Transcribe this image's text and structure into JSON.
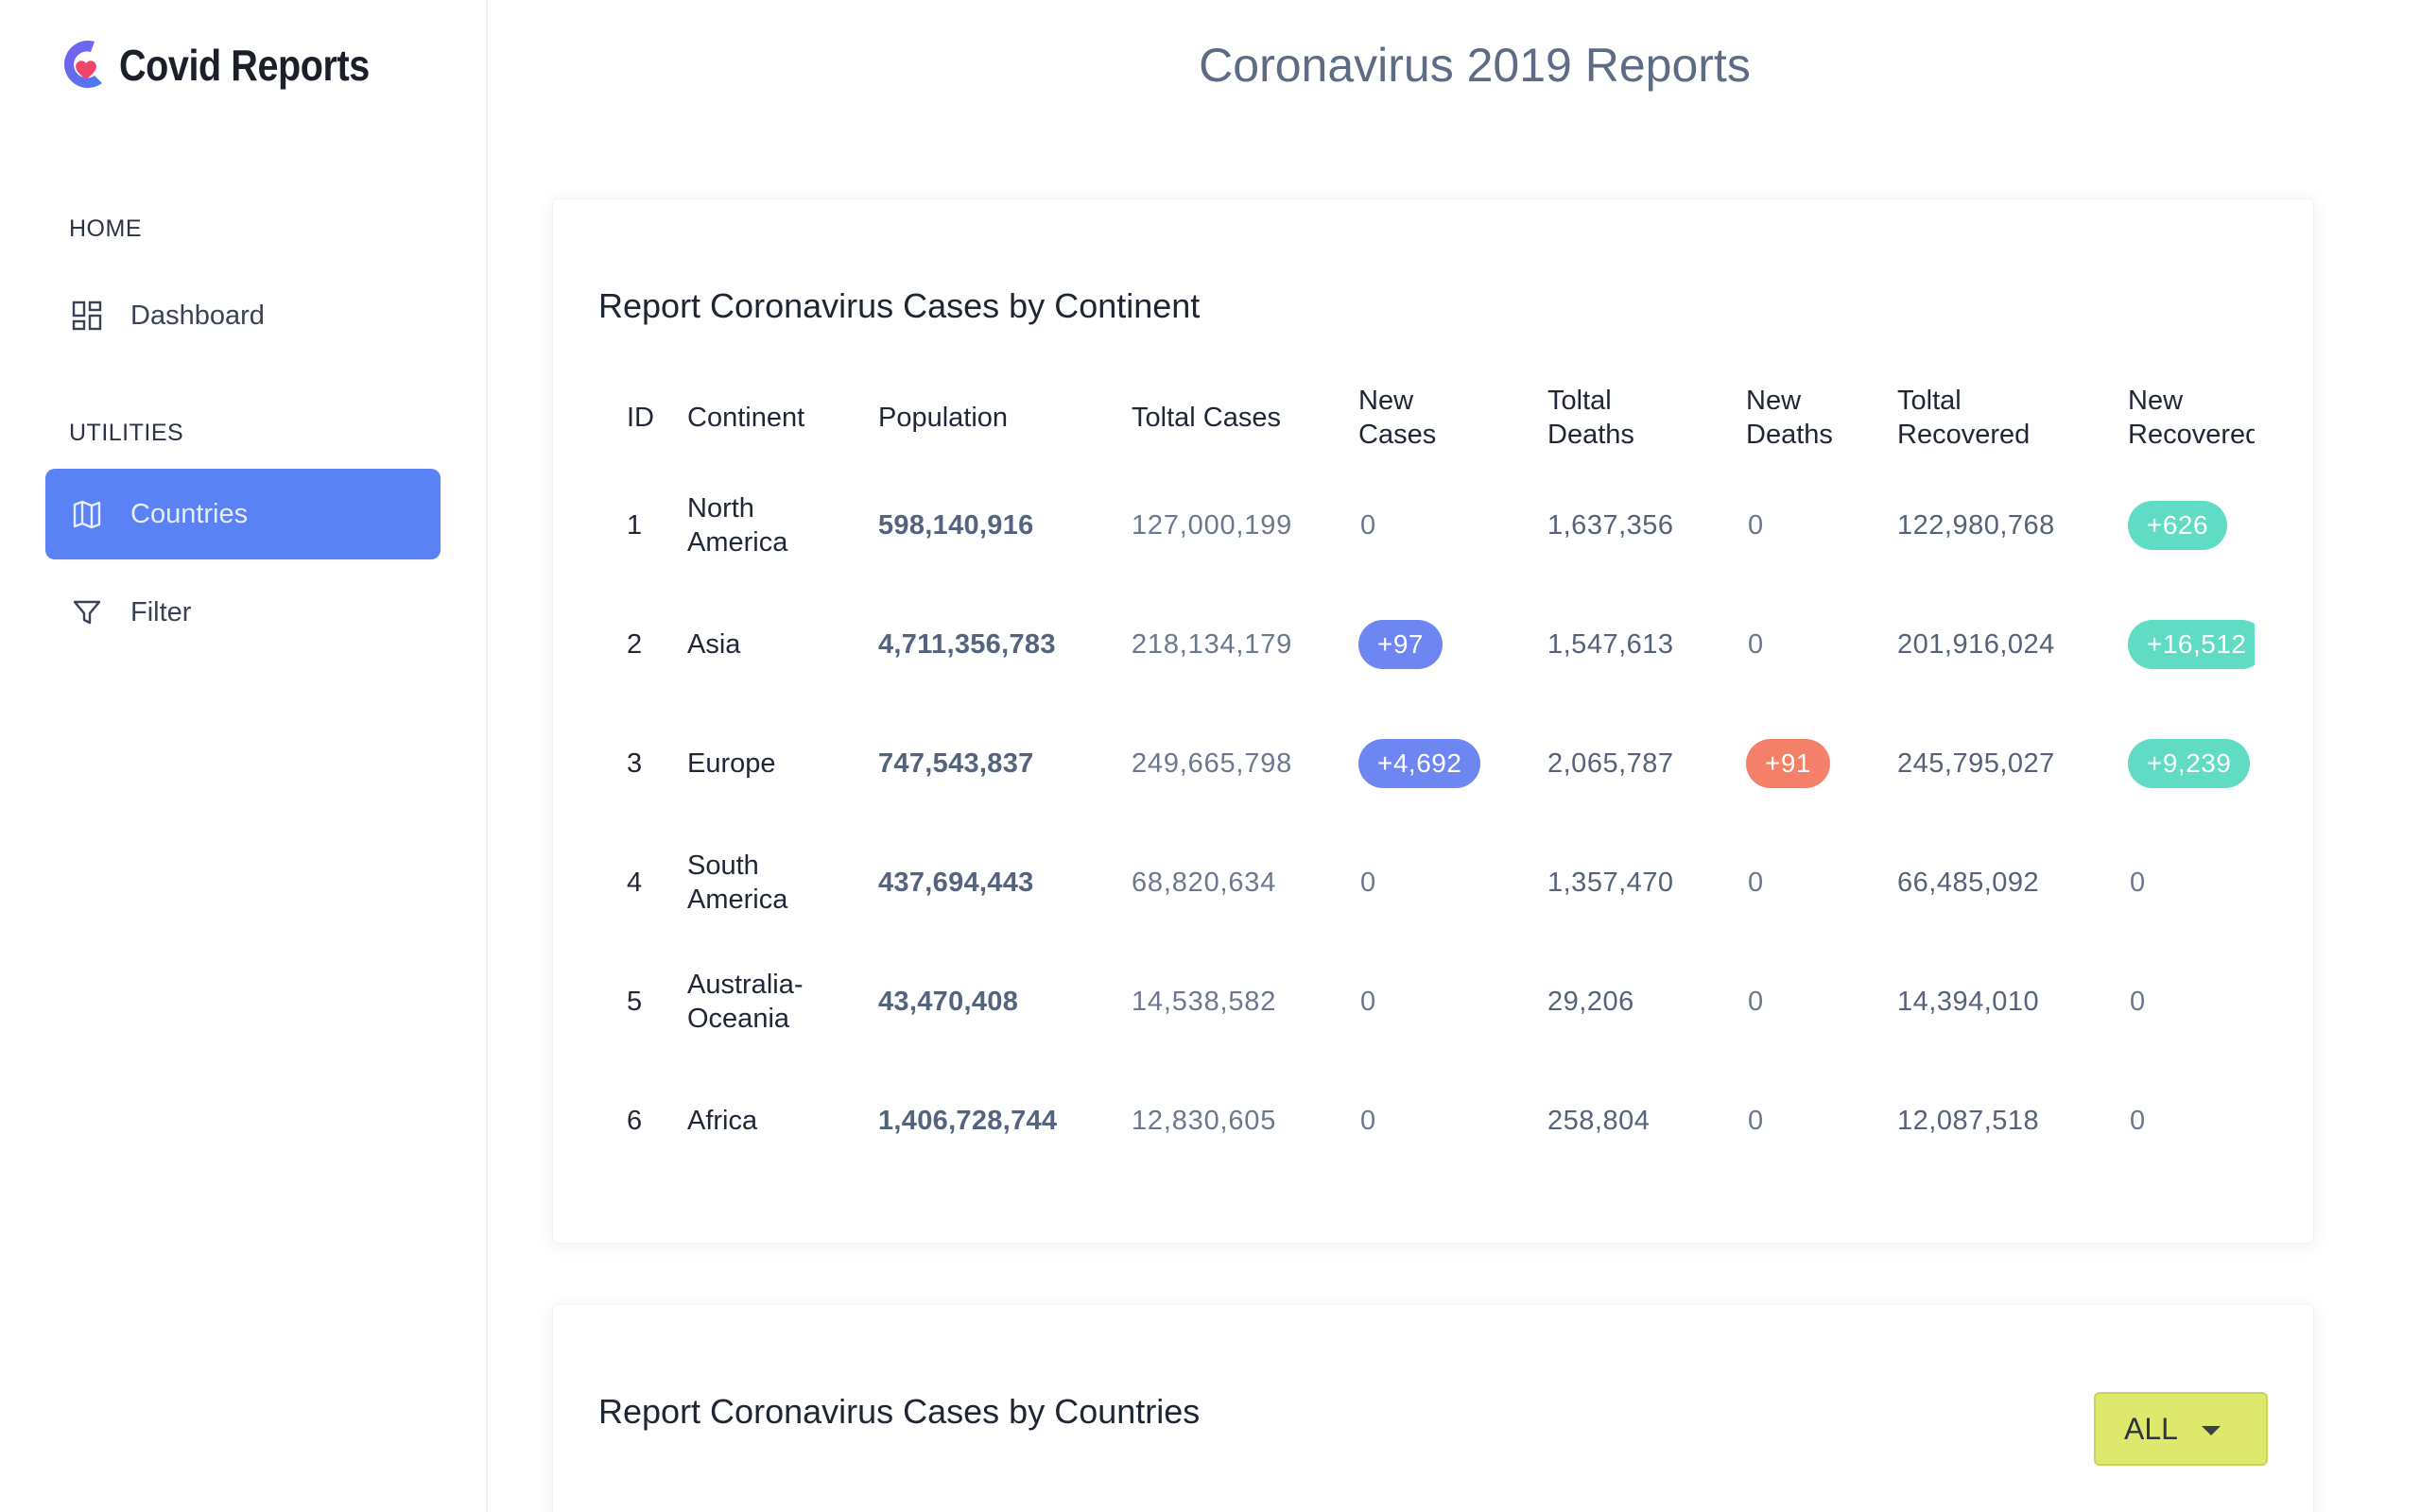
{
  "app": {
    "logo_text": "Covid Reports",
    "page_title": "Coronavirus 2019 Reports"
  },
  "sidebar": {
    "sections": [
      {
        "label": "HOME"
      },
      {
        "label": "UTILITIES"
      }
    ],
    "items": [
      {
        "label": "Dashboard",
        "icon": "dashboard-icon"
      },
      {
        "label": "Countries",
        "icon": "map-icon"
      },
      {
        "label": "Filter",
        "icon": "filter-icon"
      }
    ]
  },
  "continents_card": {
    "title": "Report Coronavirus Cases by Continent",
    "headers": [
      "ID",
      "Continent",
      "Population",
      "Toltal Cases",
      "New Cases",
      "Toltal Deaths",
      "New Deaths",
      "Toltal Recovered",
      "New Recovered"
    ],
    "header_lines": [
      [
        "ID"
      ],
      [
        "Continent"
      ],
      [
        "Population"
      ],
      [
        "Toltal Cases"
      ],
      [
        "New",
        "Cases"
      ],
      [
        "Toltal",
        "Deaths"
      ],
      [
        "New",
        "Deaths"
      ],
      [
        "Toltal",
        "Recovered"
      ],
      [
        "New",
        "Recovered"
      ]
    ],
    "rows": [
      {
        "id": "1",
        "continent": [
          "North",
          "America"
        ],
        "population": "598,140,916",
        "total_cases": "127,000,199",
        "new_cases": "0",
        "total_deaths": "1,637,356",
        "new_deaths": "0",
        "total_recovered": "122,980,768",
        "new_recovered": "+626"
      },
      {
        "id": "2",
        "continent": [
          "Asia"
        ],
        "population": "4,711,356,783",
        "total_cases": "218,134,179",
        "new_cases": "+97",
        "total_deaths": "1,547,613",
        "new_deaths": "0",
        "total_recovered": "201,916,024",
        "new_recovered": "+16,512"
      },
      {
        "id": "3",
        "continent": [
          "Europe"
        ],
        "population": "747,543,837",
        "total_cases": "249,665,798",
        "new_cases": "+4,692",
        "total_deaths": "2,065,787",
        "new_deaths": "+91",
        "total_recovered": "245,795,027",
        "new_recovered": "+9,239"
      },
      {
        "id": "4",
        "continent": [
          "South",
          "America"
        ],
        "population": "437,694,443",
        "total_cases": "68,820,634",
        "new_cases": "0",
        "total_deaths": "1,357,470",
        "new_deaths": "0",
        "total_recovered": "66,485,092",
        "new_recovered": "0"
      },
      {
        "id": "5",
        "continent": [
          "Australia-",
          "Oceania"
        ],
        "population": "43,470,408",
        "total_cases": "14,538,582",
        "new_cases": "0",
        "total_deaths": "29,206",
        "new_deaths": "0",
        "total_recovered": "14,394,010",
        "new_recovered": "0"
      },
      {
        "id": "6",
        "continent": [
          "Africa"
        ],
        "population": "1,406,728,744",
        "total_cases": "12,830,605",
        "new_cases": "0",
        "total_deaths": "258,804",
        "new_deaths": "0",
        "total_recovered": "12,087,518",
        "new_recovered": "0"
      }
    ]
  },
  "countries_card": {
    "title": "Report Coronavirus Cases by Countries",
    "filter_value": "ALL"
  },
  "colors": {
    "accent": "#5b82f4",
    "pill_blue": "#6e86f2",
    "pill_red": "#f4806a",
    "pill_green": "#5fdcc3",
    "filter_bg": "#dde86c"
  }
}
